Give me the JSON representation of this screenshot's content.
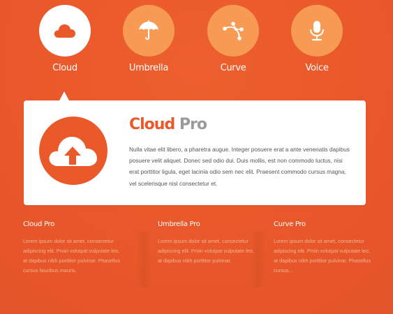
{
  "tabs": [
    {
      "label": "Cloud",
      "icon": "cloud-icon",
      "active": true
    },
    {
      "label": "Umbrella",
      "icon": "umbrella-icon",
      "active": false
    },
    {
      "label": "Curve",
      "icon": "curve-icon",
      "active": false
    },
    {
      "label": "Voice",
      "icon": "microphone-icon",
      "active": false
    }
  ],
  "panel": {
    "title_part1": "Cloud",
    "title_part2": "Pro",
    "icon": "cloud-upload-icon",
    "description": "Nulla vitae elit libero, a pharetra augue. Integer posuere erat a ante venenatis dapibus posuere velit aliquet. Donec sed odio dui. Duis mollis, est non commodo luctus, nisi erat porttitor ligula, eget lacinia odio sem nec elit. Praesent commodo cursus magna, vel scelerisque nisl consectetur et."
  },
  "columns": [
    {
      "title": "Cloud Pro",
      "text": "Lorem ipsum dolor sit amet, consectetur adipiscing elit. Proin volutpat vulputate leo, at dapibus nibh porttitor pulvinar. Phasellus cursus faucibus mauris."
    },
    {
      "title": "Umbrella Pro",
      "text": "Lorem ipsum dolor sit amet, consectetur adipiscing elit. Proin volutpat vulputate leo, at dapibus nibh porttitor pulvinar."
    },
    {
      "title": "Curve Pro",
      "text": "Lorem ipsum dolor sit amet, consectetur adipiscing elit. Proin volutpat vulputate leo, at dapibus nibh porttitor pulvinar. Phasellus cursus..."
    }
  ],
  "colors": {
    "background": "#e9592a",
    "tab_circle": "#f69a54",
    "active_tab_circle": "#ffffff",
    "title_secondary": "#9a9a9a",
    "column_text": "#f6b28e"
  }
}
